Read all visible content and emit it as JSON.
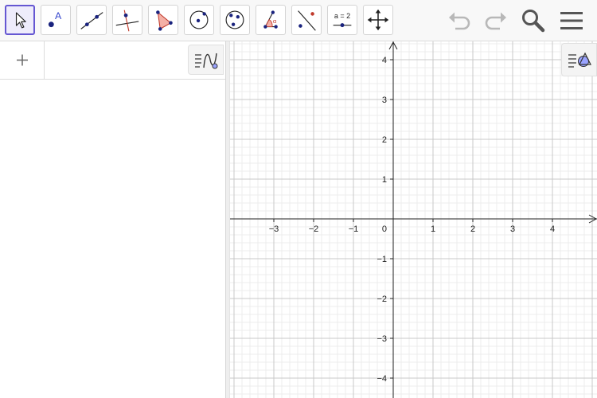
{
  "toolbar": {
    "tools": [
      {
        "id": "move",
        "icon": "move-arrow-icon",
        "selected": true
      },
      {
        "id": "point",
        "icon": "point-icon",
        "label": "A"
      },
      {
        "id": "line",
        "icon": "line-through-points-icon"
      },
      {
        "id": "perpendicular",
        "icon": "perpendicular-line-icon"
      },
      {
        "id": "polygon",
        "icon": "polygon-icon"
      },
      {
        "id": "circle",
        "icon": "circle-center-point-icon"
      },
      {
        "id": "circle3",
        "icon": "circle-three-points-icon"
      },
      {
        "id": "angle",
        "icon": "angle-icon",
        "label": "α"
      },
      {
        "id": "reflect",
        "icon": "reflect-about-line-icon"
      },
      {
        "id": "slider",
        "icon": "slider-icon",
        "label": "a = 2"
      },
      {
        "id": "pan",
        "icon": "move-graphics-view-icon"
      }
    ],
    "header_buttons": [
      "undo-icon",
      "redo-icon",
      "search-icon",
      "menu-icon"
    ]
  },
  "algebra": {
    "add_icon": "plus-icon",
    "style_icon": "algebra-style-icon"
  },
  "graphics": {
    "style_icon": "graphics-style-icon",
    "x_ticks": [
      "−3",
      "−2",
      "−1",
      "1",
      "2",
      "3",
      "4"
    ],
    "y_ticks": [
      "4",
      "3",
      "2",
      "1",
      "−1",
      "−2",
      "−3",
      "−4"
    ],
    "origin_label": "0",
    "x_range": [
      -4,
      5
    ],
    "y_range": [
      -4.5,
      4.5
    ],
    "grid": true,
    "colors": {
      "major": "#c8c8c8",
      "minor": "#ececec",
      "axis": "#222222"
    }
  }
}
